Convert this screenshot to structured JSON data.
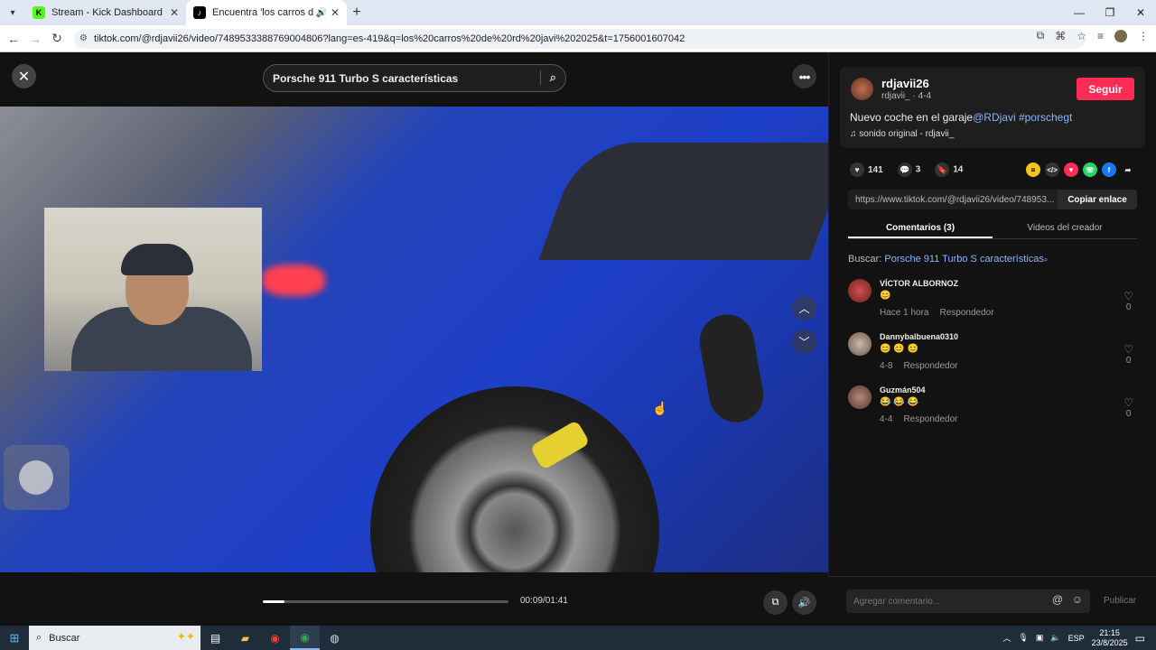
{
  "browser": {
    "tabs": [
      {
        "title": "Stream - Kick Dashboard",
        "active": false
      },
      {
        "title": "Encuentra 'los carros de rd",
        "active": true
      }
    ],
    "url": "tiktok.com/@rdjavii26/video/7489533388769004806?lang=es-419&q=los%20carros%20de%20rd%20javi%202025&t=1756001607042"
  },
  "viewer": {
    "search_value": "Porsche 911 Turbo S características",
    "time": "00:09/01:41",
    "progress": 0.09
  },
  "side": {
    "username": "rdjavii26",
    "subline": "rdjavii_ · 4-4",
    "follow_label": "Seguir",
    "caption_text": "Nuevo coche en el garaje",
    "caption_tags": "@RDjavi #porschegt",
    "sound": "sonido original - rdjavii_",
    "likes": "141",
    "comments_count": "3",
    "saves": "14",
    "link": "https://www.tiktok.com/@rdjavii26/video/748953...",
    "copy_label": "Copiar enlace",
    "tab_comments": "Comentarios (3)",
    "tab_creator": "Videos del creador",
    "search_prefix": "Buscar:",
    "search_query": "Porsche 911 Turbo S características",
    "comments": [
      {
        "name": "VÍCTOR ALBORNOZ",
        "text": "😊",
        "date": "Hace 1 hora",
        "reply": "Respondedor",
        "likes": "0"
      },
      {
        "name": "Dannybalbuena0310",
        "text": "😊 😊 😊",
        "date": "4-8",
        "reply": "Respondedor",
        "likes": "0"
      },
      {
        "name": "Guzmán504",
        "text": "😂 😂 😂",
        "date": "4-4",
        "reply": "Respondedor",
        "likes": "0"
      }
    ],
    "add_comment_placeholder": "Agregar comentario...",
    "publish_label": "Publicar"
  },
  "taskbar": {
    "search_label": "Buscar",
    "lang": "ESP",
    "time": "21:15",
    "date": "23/8/2025"
  },
  "colors": {
    "accent": "#fe2c55",
    "link": "#8ab4f8"
  }
}
